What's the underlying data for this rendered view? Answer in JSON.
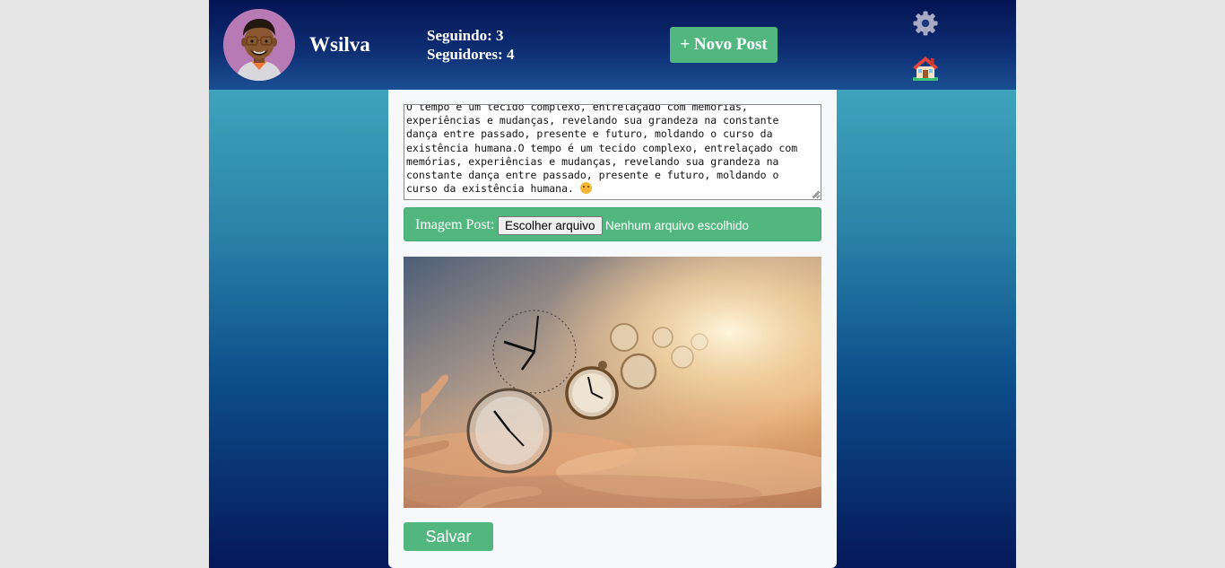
{
  "profile": {
    "username": "Wsilva",
    "following": "Seguindo: 3",
    "followers": "Seguidores: 4"
  },
  "header": {
    "new_post_label": "+ Novo Post",
    "settings_icon": "gear-icon",
    "home_icon": "home-icon"
  },
  "post": {
    "text_lines": [
      "O tempo é um tecido complexo, entrelaçado com memórias,",
      "experiências e mudanças, revelando sua grandeza na constante",
      "dança entre passado, presente e futuro, moldando o curso da",
      "existência humana.O tempo é um tecido complexo, entrelaçado com",
      "memórias, experiências e mudanças, revelando sua grandeza na",
      "constante dança entre passado, presente e futuro, moldando o",
      "curso da existência humana."
    ],
    "image_label": "Imagem Post:",
    "file_button": "Escolher arquivo",
    "file_status": "Nenhum arquivo escolhido",
    "save_label": "Salvar"
  },
  "colors": {
    "accent_green": "#52b77f",
    "header_navy": "#041453",
    "page_teal": "#4cb8c8"
  }
}
